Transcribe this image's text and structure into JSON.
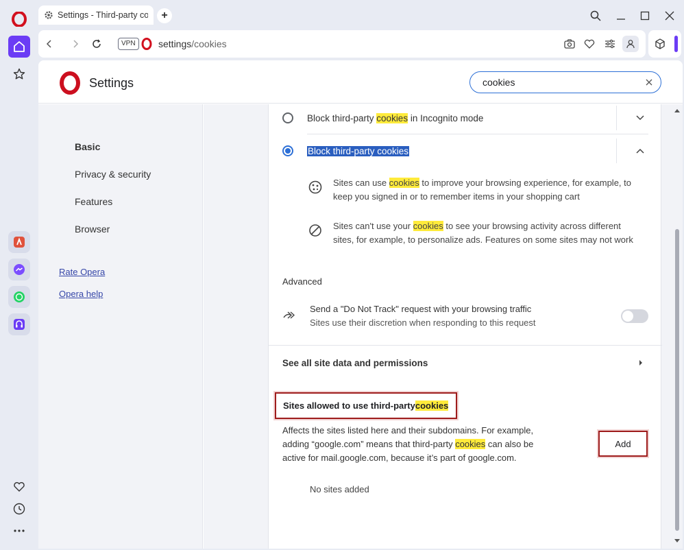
{
  "tab": {
    "title": "Settings - Third-party coo"
  },
  "address": {
    "vpn_label": "VPN",
    "url_host": "settings",
    "url_path": "/cookies"
  },
  "header": {
    "title": "Settings",
    "search_value": "cookies"
  },
  "nav": {
    "items": [
      "Basic",
      "Privacy & security",
      "Features",
      "Browser"
    ],
    "links": [
      "Rate Opera",
      "Opera help"
    ]
  },
  "options": {
    "incognito": {
      "before": "Block third-party ",
      "hl": "cookies",
      "after": " in Incognito mode"
    },
    "block_all": {
      "label": "Block third-party cookies"
    }
  },
  "descriptions": [
    {
      "before": "Sites can use ",
      "hl": "cookies",
      "after": " to improve your browsing experience, for example, to keep you signed in or to remember items in your shopping cart"
    },
    {
      "before": "Sites can't use your ",
      "hl": "cookies",
      "after": " to see your browsing activity across different sites, for example, to personalize ads. Features on some sites may not work"
    }
  ],
  "advanced": {
    "label": "Advanced",
    "dnt_title": "Send a \"Do Not Track\" request with your browsing traffic",
    "dnt_sub": "Sites use their discretion when responding to this request"
  },
  "see_all": "See all site data and permissions",
  "allowed": {
    "title_before": "Sites allowed to use third-party ",
    "title_hl": "cookies",
    "affects_before": "Affects the sites listed here and their subdomains. For example, adding “google.com” means that third-party ",
    "affects_hl": "cookies",
    "affects_after": " can also be active for mail.google.com, because it’s part of google.com.",
    "add_label": "Add",
    "empty": "No sites added"
  },
  "colors": {
    "accent": "#6b3cf5",
    "link": "#3546a8",
    "highlight": "#ffeb3b",
    "focus": "#9e1c1c"
  }
}
